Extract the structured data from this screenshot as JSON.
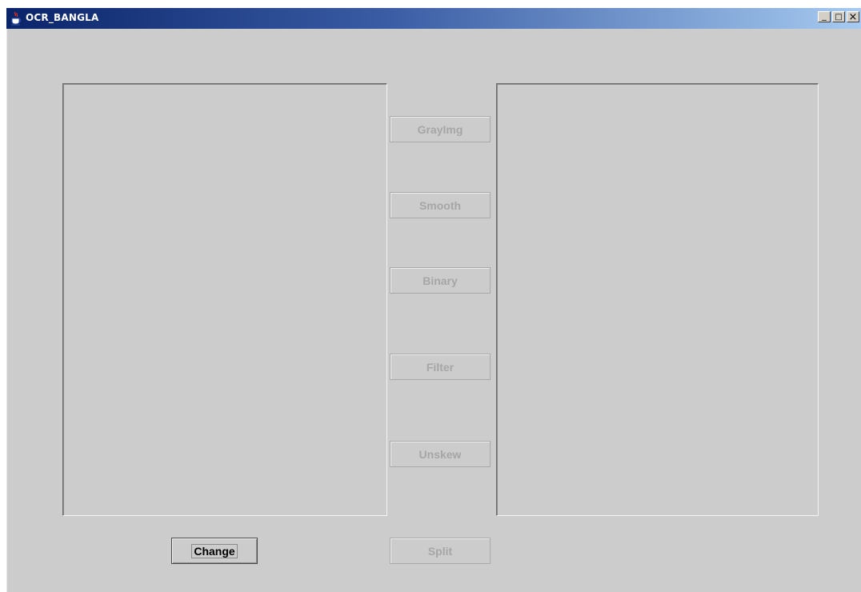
{
  "window": {
    "title": "OCR_BANGLA",
    "controls": {
      "minimize": "_",
      "maximize": "□",
      "close": "×"
    }
  },
  "buttons": {
    "grayimg": "GrayImg",
    "smooth": "Smooth",
    "binary": "Binary",
    "filter": "Filter",
    "unskew": "Unskew",
    "split": "Split",
    "change": "Change"
  },
  "icons": {
    "app": "java-coffee-cup-icon"
  },
  "colors": {
    "titlebar_start": "#0a246a",
    "titlebar_end": "#a6caf0",
    "window_bg": "#cccccc",
    "disabled_text": "#a6a6a6"
  }
}
